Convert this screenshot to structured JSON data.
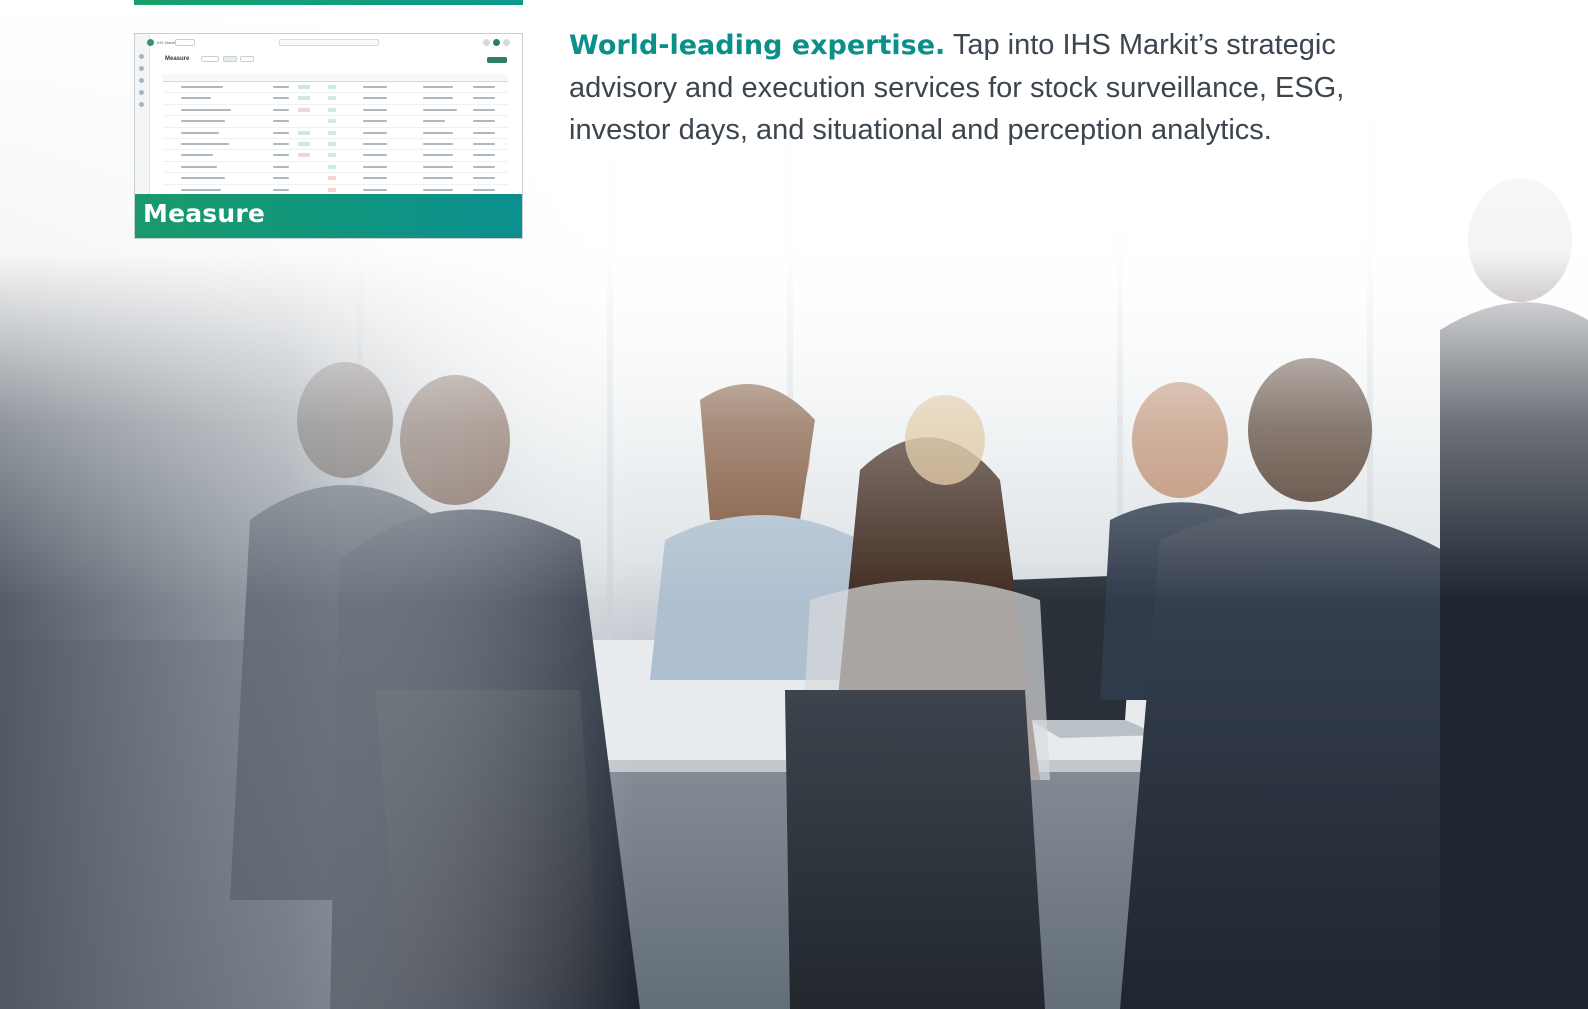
{
  "thumbnail": {
    "caption": "Measure",
    "app_name": "IHS Markit",
    "screen_title": "Measure"
  },
  "intro": {
    "lead": "World-leading expertise.",
    "body": "Tap into IHS Markit’s strategic advisory and execution services for stock surveillance, ESG, investor days, and situational and perception analytics."
  },
  "colors": {
    "accent_teal": "#0b8f8a",
    "accent_green": "#16a06a",
    "body_text": "#3b4650"
  }
}
